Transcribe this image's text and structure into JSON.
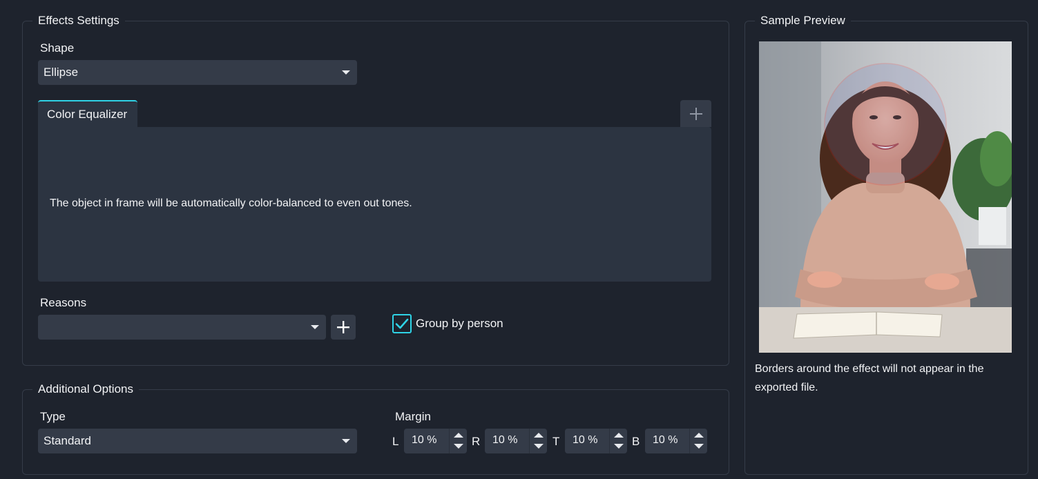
{
  "effects_settings": {
    "title": "Effects Settings",
    "shape_label": "Shape",
    "shape_value": "Ellipse",
    "tab_label": "Color Equalizer",
    "tab_description": "The object in frame will be automatically color-balanced to even out tones.",
    "reasons_label": "Reasons",
    "reasons_value": "",
    "group_by_person_label": "Group by person",
    "group_by_person_checked": true
  },
  "additional_options": {
    "title": "Additional Options",
    "type_label": "Type",
    "type_value": "Standard",
    "margin_label": "Margin",
    "margins": [
      {
        "letter": "L",
        "value": "10 %"
      },
      {
        "letter": "R",
        "value": "10 %"
      },
      {
        "letter": "T",
        "value": "10 %"
      },
      {
        "letter": "B",
        "value": "10 %"
      }
    ]
  },
  "sample_preview": {
    "title": "Sample Preview",
    "note": "Borders around the effect will not appear in the exported file."
  },
  "colors": {
    "background": "#1e232d",
    "panel": "#2c3441",
    "control": "#343b48",
    "accent": "#2fd3e6",
    "ellipse_border": "#e0202e"
  }
}
